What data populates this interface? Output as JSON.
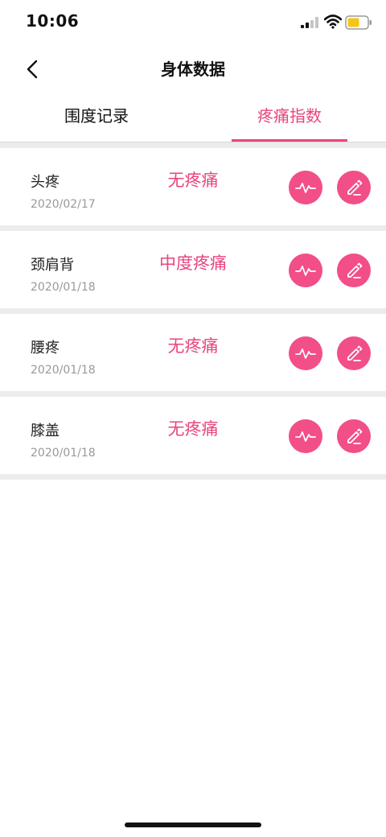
{
  "status_bar": {
    "time": "10:06"
  },
  "header": {
    "title": "身体数据"
  },
  "tabs": [
    {
      "label": "围度记录",
      "active": false
    },
    {
      "label": "疼痛指数",
      "active": true
    }
  ],
  "records": [
    {
      "name": "头疼",
      "date": "2020/02/17",
      "level": "无疼痛"
    },
    {
      "name": "颈肩背",
      "date": "2020/01/18",
      "level": "中度疼痛"
    },
    {
      "name": "腰疼",
      "date": "2020/01/18",
      "level": "无疼痛"
    },
    {
      "name": "膝盖",
      "date": "2020/01/18",
      "level": "无疼痛"
    }
  ],
  "icons": {
    "back": "chevron-left-icon",
    "chart": "pulse-chart-icon",
    "edit": "pencil-icon"
  },
  "colors": {
    "accent": "#e8457f",
    "button": "#f24e88",
    "battery": "#f5c518"
  }
}
